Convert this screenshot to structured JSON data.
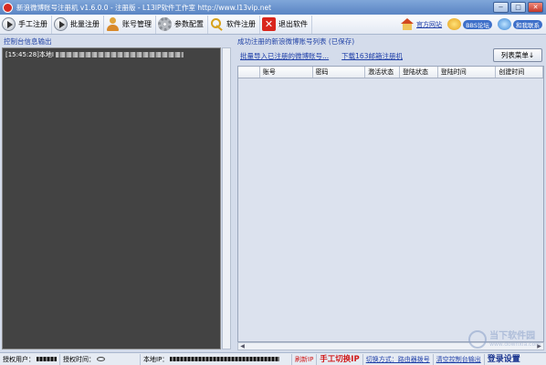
{
  "window": {
    "title": "新浪微博账号注册机 v1.6.0.0 - 注册版 - L13IP软件工作室 http://www.l13vip.net",
    "min": "−",
    "max": "□",
    "close": "✕"
  },
  "toolbar": {
    "buttons": [
      {
        "label": "手工注册",
        "icon": "play-icon"
      },
      {
        "label": "批量注册",
        "icon": "play-icon"
      },
      {
        "label": "账号管理",
        "icon": "user-icon"
      },
      {
        "label": "参数配置",
        "icon": "gear-icon"
      },
      {
        "label": "软件注册",
        "icon": "key-icon"
      },
      {
        "label": "退出软件",
        "icon": "exit-icon"
      }
    ],
    "links": [
      {
        "label": "官方网站",
        "icon": "home-icon"
      },
      {
        "label": "BBS论坛",
        "icon": "badge-icon"
      },
      {
        "label": "和我联系",
        "icon": "contact-icon"
      }
    ]
  },
  "left": {
    "title": "控制台信息输出",
    "log": [
      {
        "time": "[15:45:28]",
        "text": "本地I"
      }
    ]
  },
  "right": {
    "title": "成功注册的新浪微博账号列表 (已保存)",
    "import_link": "批量导入已注册的微博账号...",
    "download_link": "下载163邮箱注册机",
    "menu_button": "列表菜单↓",
    "columns": [
      "",
      "账号",
      "密码",
      "激活状态",
      "登陆状态",
      "登陆时间",
      "创建时间"
    ]
  },
  "status": {
    "auth_user": "授权用户：",
    "auth_time": "授权时间：",
    "local_ip": "本地IP：",
    "refresh_ip": "刷新IP",
    "manual_switch": "手工切换IP",
    "switch_mode": "切换方式：路由器拨号",
    "clear_console": "清空控制台输出",
    "login_settings": "登录设置"
  },
  "watermark": {
    "name": "当下软件园",
    "url": "www.downxia.com"
  },
  "colors": {
    "accent": "#1f3fa8",
    "console_bg": "#434343",
    "alert": "#d01818"
  }
}
